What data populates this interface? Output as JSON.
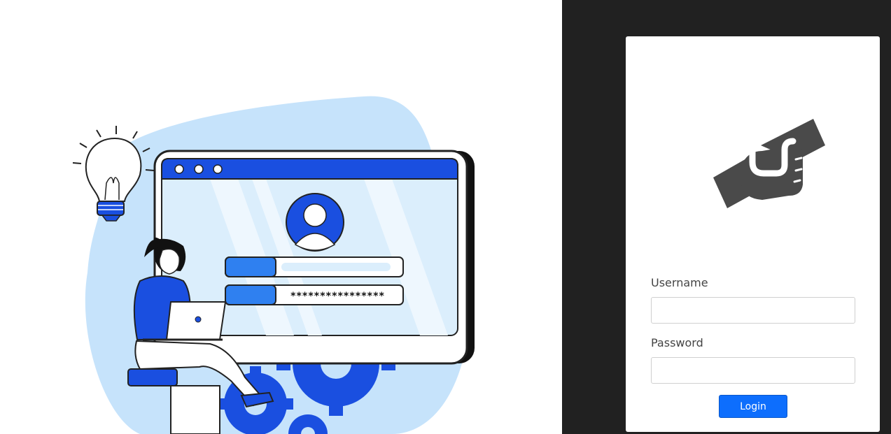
{
  "login": {
    "username_label": "Username",
    "username_value": "",
    "password_label": "Password",
    "password_value": "",
    "login_button_label": "Login"
  },
  "illustration": {
    "masked_password_text": "****************"
  },
  "colors": {
    "dark_panel": "#212121",
    "login_button": "#0d6efd",
    "logo_gray": "#4a4a4a",
    "illustration_blue": "#1a4fe0",
    "illustration_light_blue": "#c6e3fb"
  },
  "icons": {
    "brand_logo": "handshake-icon",
    "illustration_idea": "lightbulb-icon",
    "illustration_profile": "user-avatar-icon"
  }
}
